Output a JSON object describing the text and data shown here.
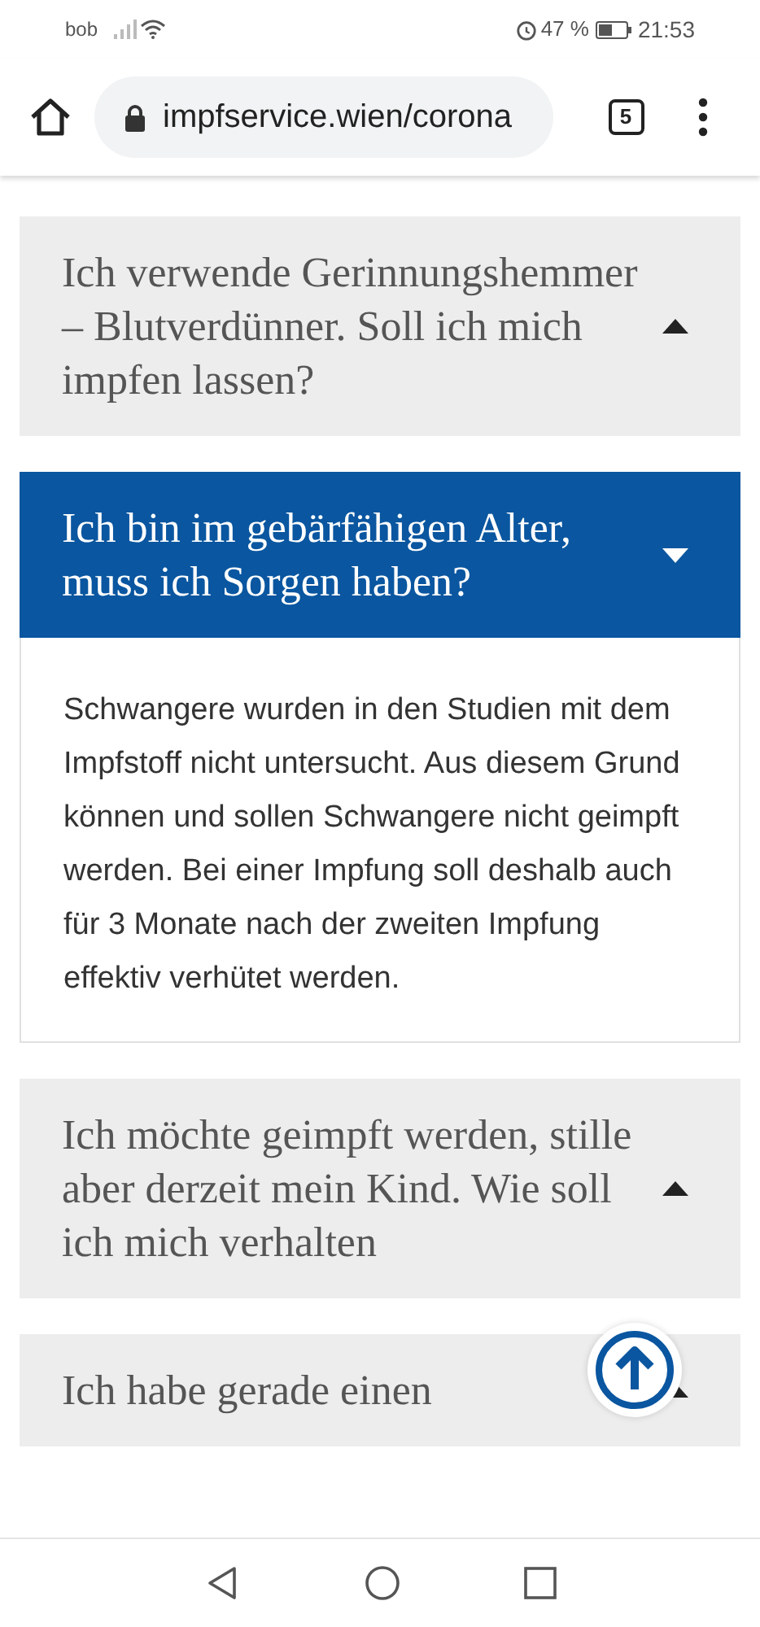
{
  "status_bar": {
    "carrier": "bob",
    "battery": "47 %",
    "time": "21:53"
  },
  "browser": {
    "url": "impfservice.wien/corona",
    "tab_count": "5"
  },
  "faq": [
    {
      "question": "Ich verwende Gerinnungshemmer – Blutverdünner. Soll ich mich impfen lassen?",
      "expanded": false
    },
    {
      "question": "Ich bin im gebärfähigen Alter, muss ich Sorgen haben?",
      "expanded": true,
      "answer": "Schwangere wurden in den Studien mit dem Impfstoff nicht untersucht. Aus diesem Grund können und sollen Schwangere nicht geimpft werden. Bei einer Impfung soll deshalb auch für 3 Monate nach der zweiten Impfung effektiv verhütet werden."
    },
    {
      "question": "Ich möchte geimpft werden, stille aber derzeit mein Kind. Wie soll ich mich verhalten",
      "expanded": false
    },
    {
      "question": "Ich habe gerade einen",
      "expanded": false
    }
  ]
}
